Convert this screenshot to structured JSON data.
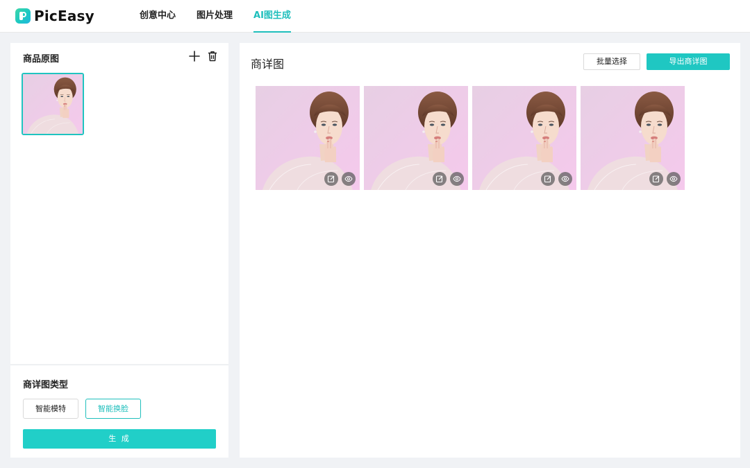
{
  "app": {
    "name": "PicEasy",
    "brand_color": "#1fbfbc"
  },
  "nav": {
    "items": [
      {
        "label": "创意中心",
        "active": false
      },
      {
        "label": "图片处理",
        "active": false
      },
      {
        "label": "AI图生成",
        "active": true
      }
    ]
  },
  "left_panel": {
    "title": "商品原图",
    "add_icon": "plus-icon",
    "delete_icon": "trash-icon",
    "type_title": "商详图类型",
    "type_options": [
      {
        "label": "智能模特",
        "selected": false
      },
      {
        "label": "智能换脸",
        "selected": true
      }
    ],
    "generate_label": "生 成"
  },
  "main_panel": {
    "title": "商详图",
    "batch_select_label": "批量选择",
    "export_label": "导出商详图",
    "results": [
      {
        "edit_icon": "edit-icon",
        "preview_icon": "eye-icon"
      },
      {
        "edit_icon": "edit-icon",
        "preview_icon": "eye-icon"
      },
      {
        "edit_icon": "edit-icon",
        "preview_icon": "eye-icon"
      },
      {
        "edit_icon": "edit-icon",
        "preview_icon": "eye-icon"
      }
    ]
  }
}
